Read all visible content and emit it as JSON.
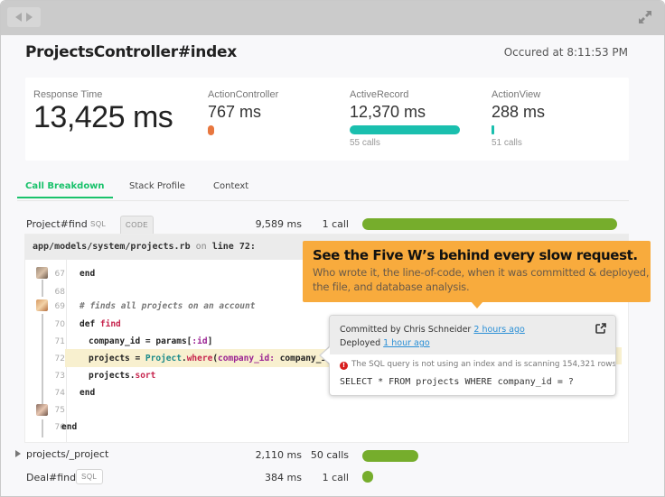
{
  "window": {
    "nav_back_icon": "triangle-left",
    "nav_forward_icon": "triangle-right",
    "expand_icon": "diagonal-arrows"
  },
  "header": {
    "title": "ProjectsController#index",
    "occurred": "Occured at 8:11:53 PM"
  },
  "metrics": {
    "response_time": {
      "label": "Response Time",
      "value": "13,425 ms"
    },
    "action_controller": {
      "label": "ActionController",
      "value": "767 ms",
      "bar_fraction": 0.06,
      "color": "#e8773f"
    },
    "active_record": {
      "label": "ActiveRecord",
      "value": "12,370 ms",
      "calls": "55 calls",
      "bar_fraction": 1.0,
      "color": "#1abfae"
    },
    "action_view": {
      "label": "ActionView",
      "value": "288 ms",
      "calls": "51 calls",
      "bar_fraction": 0.02,
      "color": "#1abfae"
    }
  },
  "tabs": [
    {
      "label": "Call Breakdown",
      "active": true
    },
    {
      "label": "Stack Profile",
      "active": false
    },
    {
      "label": "Context",
      "active": false
    }
  ],
  "breakdown": [
    {
      "name": "Project#find",
      "tags": [
        "SQL",
        "CODE"
      ],
      "selected_tag": "CODE",
      "ms": "9,589 ms",
      "calls": "1 call",
      "bar_fraction": 1.0,
      "color": "#76ad2c"
    },
    {
      "name": "projects/_project",
      "tags": [],
      "expandable": true,
      "ms": "2,110 ms",
      "calls": "50 calls",
      "bar_fraction": 0.22,
      "color": "#76ad2c"
    },
    {
      "name": "Deal#find",
      "tags": [
        "SQL"
      ],
      "ms": "384 ms",
      "calls": "1 call",
      "bar_fraction": 0.04,
      "color": "#76ad2c"
    }
  ],
  "code": {
    "file": "app/models/system/projects.rb",
    "on": "on",
    "line_label": "line 72:",
    "lines": [
      {
        "n": "67",
        "text": "end",
        "indent": 0
      },
      {
        "n": "68",
        "text": "",
        "indent": 0
      },
      {
        "n": "69",
        "text": "# finds all projects on an account",
        "indent": 0,
        "comment": true
      },
      {
        "n": "70",
        "text": "def find",
        "indent": 0
      },
      {
        "n": "71",
        "text": "company_id = params[:id]",
        "indent": 1
      },
      {
        "n": "72",
        "text": "projects = Project.where(company_id: company_id)",
        "indent": 1,
        "highlight": true
      },
      {
        "n": "73",
        "text": "projects.sort",
        "indent": 1
      },
      {
        "n": "74",
        "text": "end",
        "indent": 0
      },
      {
        "n": "75",
        "text": "",
        "indent": 0
      },
      {
        "n": "76",
        "text": "end",
        "indent": -1
      }
    ]
  },
  "callout": {
    "headline": "See the Five W’s behind every slow request.",
    "subtext": "Who wrote it, the line-of-code, when it was committed & deployed, the file, and database analysis."
  },
  "popover": {
    "committed_prefix": "Committed by Chris Schneider",
    "committed_link": "2 hours ago",
    "deployed_prefix": "Deployed",
    "deployed_link": "1 hour ago",
    "share_icon": "external-share",
    "warning": "The SQL query is not using an index and is scanning 154,321 rows.",
    "sql": "SELECT * FROM projects WHERE company_id = ?"
  }
}
